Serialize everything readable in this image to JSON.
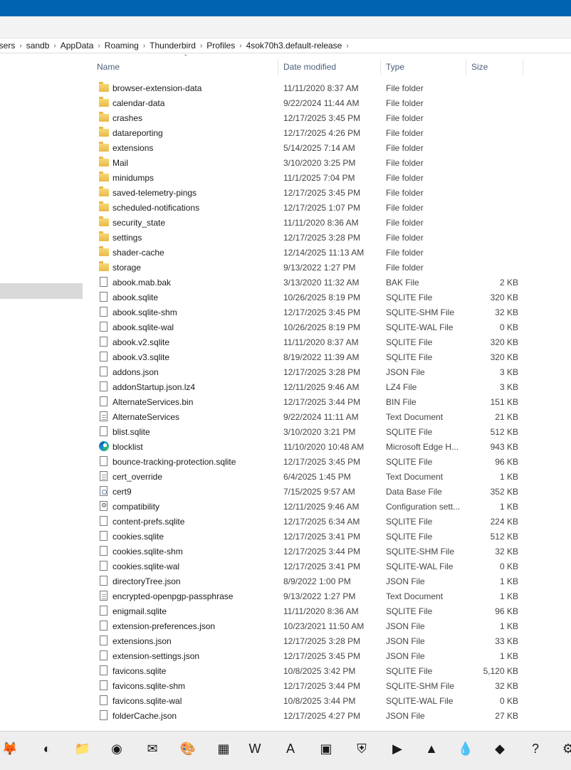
{
  "breadcrumb": [
    "Users",
    "sandb",
    "AppData",
    "Roaming",
    "Thunderbird",
    "Profiles",
    "4sok70h3.default-release"
  ],
  "columns": {
    "name": "Name",
    "date": "Date modified",
    "type": "Type",
    "size": "Size"
  },
  "files": [
    {
      "name": "browser-extension-data",
      "date": "11/11/2020 8:37 AM",
      "type": "File folder",
      "size": "",
      "icon": "folder"
    },
    {
      "name": "calendar-data",
      "date": "9/22/2024 11:44 AM",
      "type": "File folder",
      "size": "",
      "icon": "folder"
    },
    {
      "name": "crashes",
      "date": "12/17/2025 3:45 PM",
      "type": "File folder",
      "size": "",
      "icon": "folder"
    },
    {
      "name": "datareporting",
      "date": "12/17/2025 4:26 PM",
      "type": "File folder",
      "size": "",
      "icon": "folder"
    },
    {
      "name": "extensions",
      "date": "5/14/2025 7:14 AM",
      "type": "File folder",
      "size": "",
      "icon": "folder"
    },
    {
      "name": "Mail",
      "date": "3/10/2020 3:25 PM",
      "type": "File folder",
      "size": "",
      "icon": "folder"
    },
    {
      "name": "minidumps",
      "date": "11/1/2025 7:04 PM",
      "type": "File folder",
      "size": "",
      "icon": "folder"
    },
    {
      "name": "saved-telemetry-pings",
      "date": "12/17/2025 3:45 PM",
      "type": "File folder",
      "size": "",
      "icon": "folder"
    },
    {
      "name": "scheduled-notifications",
      "date": "12/17/2025 1:07 PM",
      "type": "File folder",
      "size": "",
      "icon": "folder"
    },
    {
      "name": "security_state",
      "date": "11/11/2020 8:36 AM",
      "type": "File folder",
      "size": "",
      "icon": "folder"
    },
    {
      "name": "settings",
      "date": "12/17/2025 3:28 PM",
      "type": "File folder",
      "size": "",
      "icon": "folder"
    },
    {
      "name": "shader-cache",
      "date": "12/14/2025 11:13 AM",
      "type": "File folder",
      "size": "",
      "icon": "folder"
    },
    {
      "name": "storage",
      "date": "9/13/2022 1:27 PM",
      "type": "File folder",
      "size": "",
      "icon": "folder"
    },
    {
      "name": "abook.mab.bak",
      "date": "3/13/2020 11:32 AM",
      "type": "BAK File",
      "size": "2 KB",
      "icon": "file"
    },
    {
      "name": "abook.sqlite",
      "date": "10/26/2025 8:19 PM",
      "type": "SQLITE File",
      "size": "320 KB",
      "icon": "file"
    },
    {
      "name": "abook.sqlite-shm",
      "date": "12/17/2025 3:45 PM",
      "type": "SQLITE-SHM File",
      "size": "32 KB",
      "icon": "file"
    },
    {
      "name": "abook.sqlite-wal",
      "date": "10/26/2025 8:19 PM",
      "type": "SQLITE-WAL File",
      "size": "0 KB",
      "icon": "file"
    },
    {
      "name": "abook.v2.sqlite",
      "date": "11/11/2020 8:37 AM",
      "type": "SQLITE File",
      "size": "320 KB",
      "icon": "file"
    },
    {
      "name": "abook.v3.sqlite",
      "date": "8/19/2022 11:39 AM",
      "type": "SQLITE File",
      "size": "320 KB",
      "icon": "file"
    },
    {
      "name": "addons.json",
      "date": "12/17/2025 3:28 PM",
      "type": "JSON File",
      "size": "3 KB",
      "icon": "file"
    },
    {
      "name": "addonStartup.json.lz4",
      "date": "12/11/2025 9:46 AM",
      "type": "LZ4 File",
      "size": "3 KB",
      "icon": "file"
    },
    {
      "name": "AlternateServices.bin",
      "date": "12/17/2025 3:44 PM",
      "type": "BIN File",
      "size": "151 KB",
      "icon": "file"
    },
    {
      "name": "AlternateServices",
      "date": "9/22/2024 11:11 AM",
      "type": "Text Document",
      "size": "21 KB",
      "icon": "text"
    },
    {
      "name": "blist.sqlite",
      "date": "3/10/2020 3:21 PM",
      "type": "SQLITE File",
      "size": "512 KB",
      "icon": "file"
    },
    {
      "name": "blocklist",
      "date": "11/10/2020 10:48 AM",
      "type": "Microsoft Edge H...",
      "size": "943 KB",
      "icon": "edge"
    },
    {
      "name": "bounce-tracking-protection.sqlite",
      "date": "12/17/2025 3:45 PM",
      "type": "SQLITE File",
      "size": "96 KB",
      "icon": "file"
    },
    {
      "name": "cert_override",
      "date": "6/4/2025 1:45 PM",
      "type": "Text Document",
      "size": "1 KB",
      "icon": "text"
    },
    {
      "name": "cert9",
      "date": "7/15/2025 9:57 AM",
      "type": "Data Base File",
      "size": "352 KB",
      "icon": "cert"
    },
    {
      "name": "compatibility",
      "date": "12/11/2025 9:46 AM",
      "type": "Configuration sett...",
      "size": "1 KB",
      "icon": "config"
    },
    {
      "name": "content-prefs.sqlite",
      "date": "12/17/2025 6:34 AM",
      "type": "SQLITE File",
      "size": "224 KB",
      "icon": "file"
    },
    {
      "name": "cookies.sqlite",
      "date": "12/17/2025 3:41 PM",
      "type": "SQLITE File",
      "size": "512 KB",
      "icon": "file"
    },
    {
      "name": "cookies.sqlite-shm",
      "date": "12/17/2025 3:44 PM",
      "type": "SQLITE-SHM File",
      "size": "32 KB",
      "icon": "file"
    },
    {
      "name": "cookies.sqlite-wal",
      "date": "12/17/2025 3:41 PM",
      "type": "SQLITE-WAL File",
      "size": "0 KB",
      "icon": "file"
    },
    {
      "name": "directoryTree.json",
      "date": "8/9/2022 1:00 PM",
      "type": "JSON File",
      "size": "1 KB",
      "icon": "file"
    },
    {
      "name": "encrypted-openpgp-passphrase",
      "date": "9/13/2022 1:27 PM",
      "type": "Text Document",
      "size": "1 KB",
      "icon": "text"
    },
    {
      "name": "enigmail.sqlite",
      "date": "11/11/2020 8:36 AM",
      "type": "SQLITE File",
      "size": "96 KB",
      "icon": "file"
    },
    {
      "name": "extension-preferences.json",
      "date": "10/23/2021 11:50 AM",
      "type": "JSON File",
      "size": "1 KB",
      "icon": "file"
    },
    {
      "name": "extensions.json",
      "date": "12/17/2025 3:28 PM",
      "type": "JSON File",
      "size": "33 KB",
      "icon": "file"
    },
    {
      "name": "extension-settings.json",
      "date": "12/17/2025 3:45 PM",
      "type": "JSON File",
      "size": "1 KB",
      "icon": "file"
    },
    {
      "name": "favicons.sqlite",
      "date": "10/8/2025 3:42 PM",
      "type": "SQLITE File",
      "size": "5,120 KB",
      "icon": "file"
    },
    {
      "name": "favicons.sqlite-shm",
      "date": "12/17/2025 3:44 PM",
      "type": "SQLITE-SHM File",
      "size": "32 KB",
      "icon": "file"
    },
    {
      "name": "favicons.sqlite-wal",
      "date": "10/8/2025 3:44 PM",
      "type": "SQLITE-WAL File",
      "size": "0 KB",
      "icon": "file"
    },
    {
      "name": "folderCache.json",
      "date": "12/17/2025 4:27 PM",
      "type": "JSON File",
      "size": "27 KB",
      "icon": "file"
    }
  ],
  "taskbar": [
    {
      "icon": "firefox-icon",
      "glyph": "🦊"
    },
    {
      "icon": "edge-icon",
      "glyph": "◐"
    },
    {
      "icon": "file-explorer-icon",
      "glyph": "📁"
    },
    {
      "icon": "chrome-icon",
      "glyph": "◉"
    },
    {
      "icon": "thunderbird-icon",
      "glyph": "✉"
    },
    {
      "icon": "paint-icon",
      "glyph": "🎨"
    },
    {
      "icon": "calculator-icon",
      "glyph": "▦"
    },
    {
      "icon": "word-icon",
      "glyph": "W"
    },
    {
      "icon": "acrobat-icon",
      "glyph": "A"
    },
    {
      "icon": "image-viewer-icon",
      "glyph": "▣"
    },
    {
      "icon": "shield-icon",
      "glyph": "⛨"
    },
    {
      "icon": "terminal-icon",
      "glyph": "▶"
    },
    {
      "icon": "vlc-icon",
      "glyph": "▲"
    },
    {
      "icon": "drop-icon",
      "glyph": "💧"
    },
    {
      "icon": "inkscape-icon",
      "glyph": "◆"
    },
    {
      "icon": "help-icon",
      "glyph": "?"
    },
    {
      "icon": "gear-icon",
      "glyph": "⚙"
    }
  ]
}
